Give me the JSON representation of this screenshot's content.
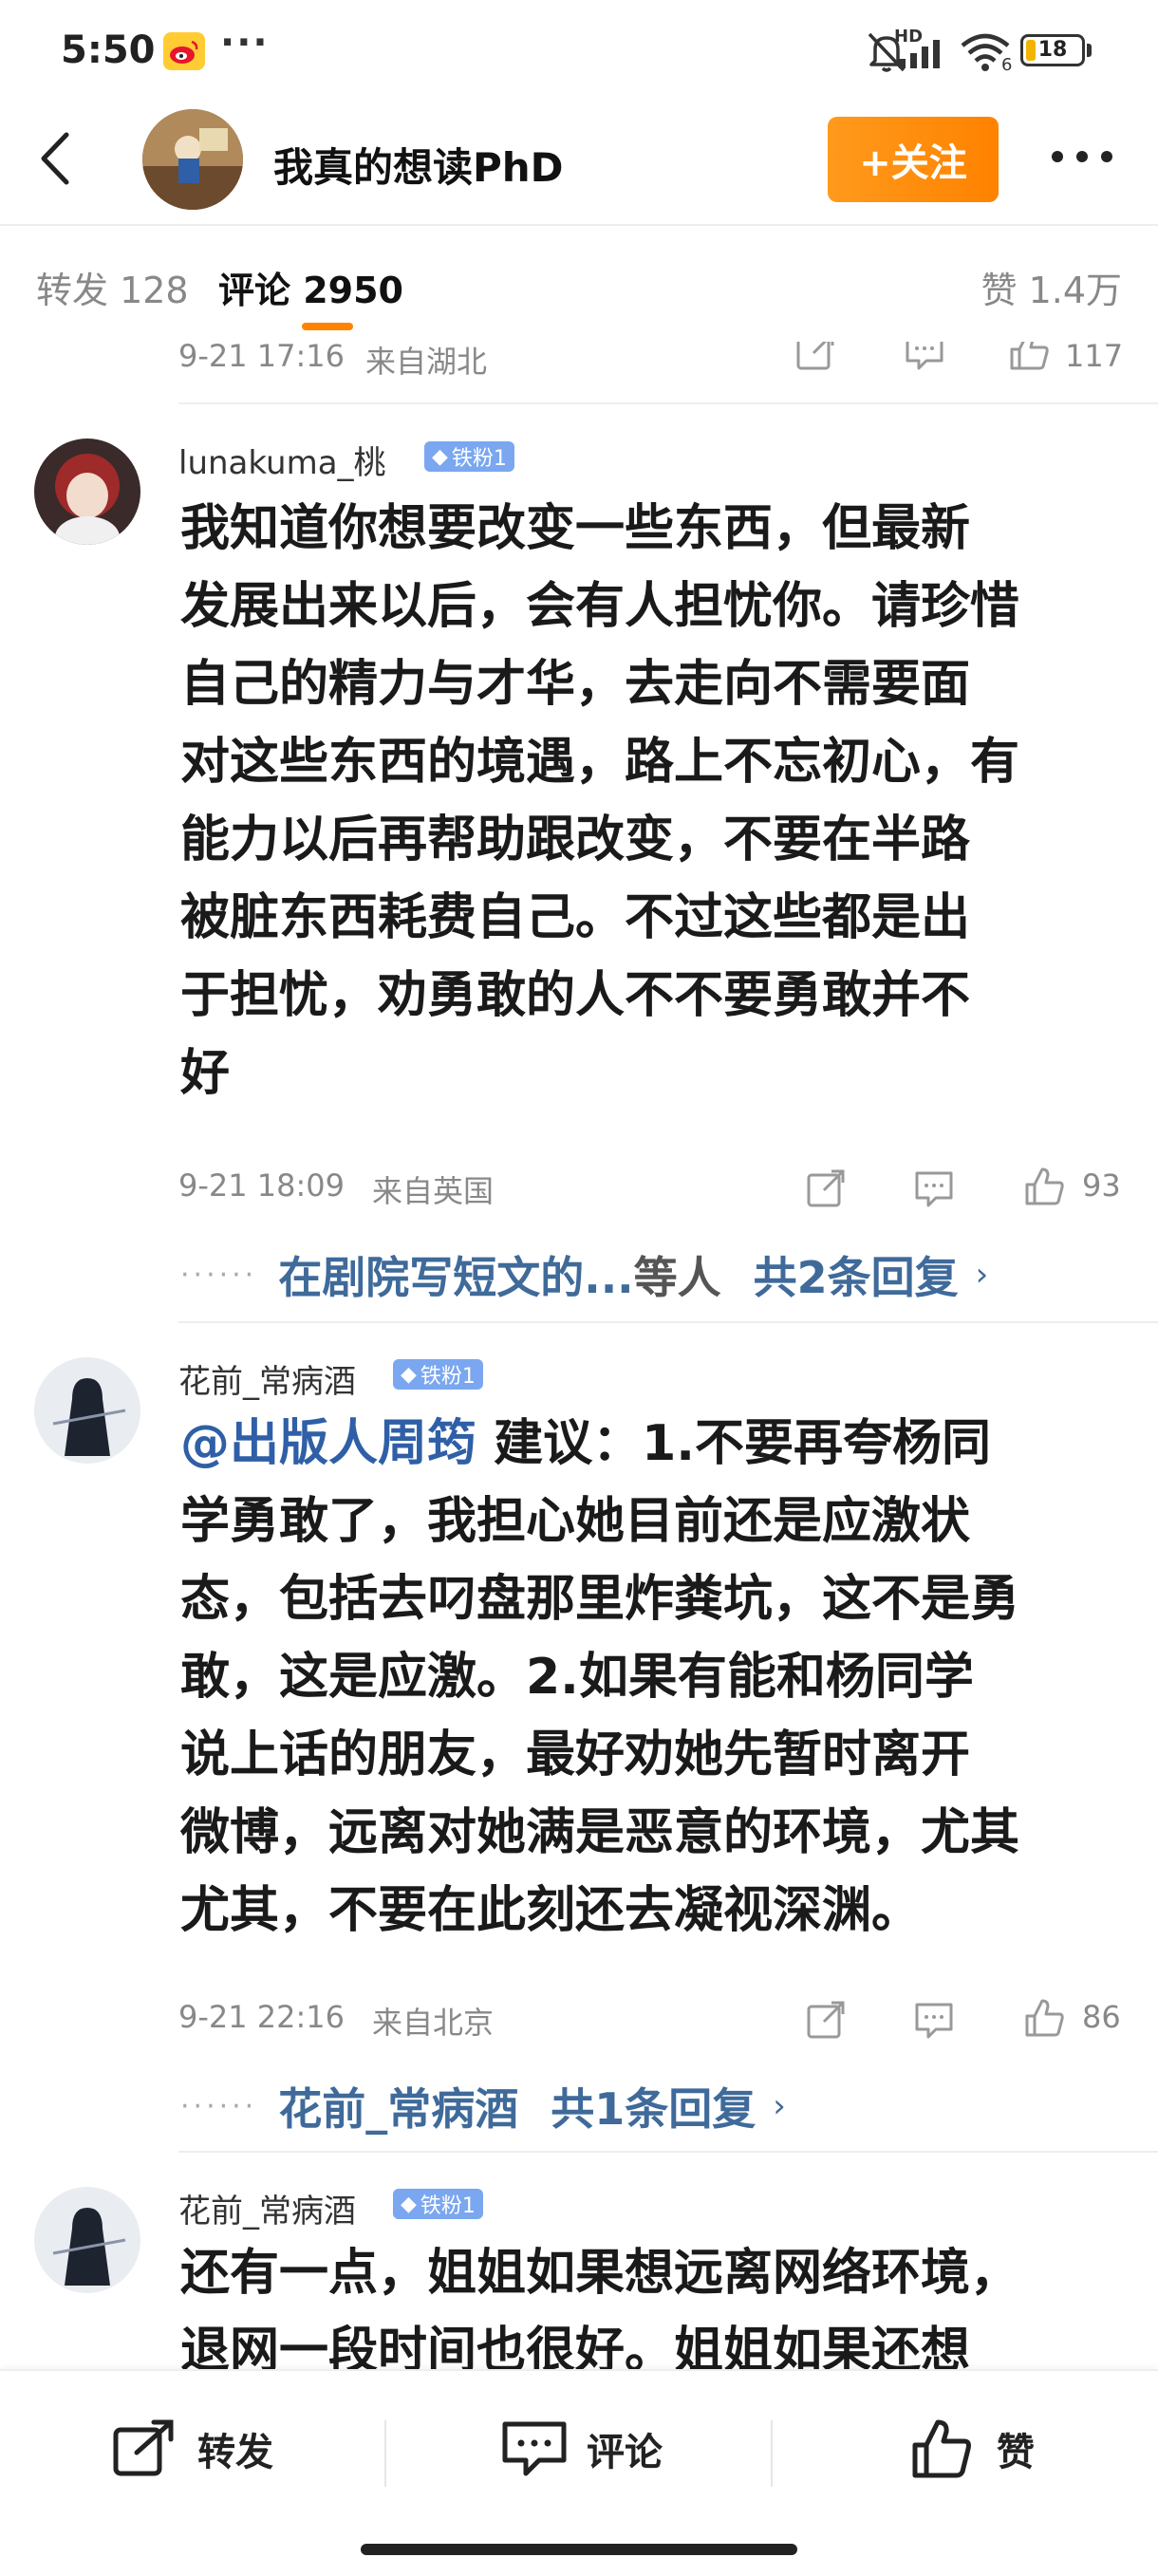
{
  "status_bar": {
    "time": "5:50",
    "dots": "···",
    "signal_label": "HD",
    "wifi_label": "6",
    "battery": "18",
    "battery_level": 0.18
  },
  "header": {
    "title": "我真的想读PhD",
    "follow_label": "+关注"
  },
  "tabs": {
    "repost": "转发 128",
    "comment": "评论 2950",
    "likes": "赞 1.4万"
  },
  "partial_meta": {
    "time": "9-21 17:16",
    "location": "来自湖北",
    "likes": "117"
  },
  "comments": [
    {
      "username": "lunakuma_桃",
      "badge": "铁粉1",
      "lines": [
        "我知道你想要改变一些东西，但最新",
        "发展出来以后，会有人担忧你。请珍惜",
        "自己的精力与才华，去走向不需要面",
        "对这些东西的境遇，路上不忘初心，有",
        "能力以后再帮助跟改变，不要在半路",
        "被脏东西耗费自己。不过这些都是出",
        "于担忧，劝勇敢的人不不要勇敢并不",
        "好"
      ],
      "time": "9-21 18:09",
      "location": "来自英国",
      "likes": "93",
      "reply_from": "在剧院写短文的...",
      "reply_mid": "等人",
      "reply_count": "共2条回复"
    },
    {
      "username": "花前_常病酒",
      "badge": "铁粉1",
      "mention": "@出版人周筠",
      "line1_rest": " 建议：1.不要再夸杨同",
      "lines": [
        "学勇敢了，我担心她目前还是应激状",
        "态，包括去叼盘那里炸粪坑，这不是勇",
        "敢，这是应激。2.如果有能和杨同学",
        "说上话的朋友，最好劝她先暂时离开",
        "微博，远离对她满是恶意的环境，尤其",
        "尤其，不要在此刻还去凝视深渊。"
      ],
      "time": "9-21 22:16",
      "location": "来自北京",
      "likes": "86",
      "reply_from": "花前_常病酒",
      "reply_count": "共1条回复"
    },
    {
      "username": "花前_常病酒",
      "badge": "铁粉1",
      "lines": [
        "还有一点，姐姐如果想远离网络环境，",
        "退网一段时间也很好。姐姐如果还想"
      ]
    }
  ],
  "bottom_bar": {
    "repost": "转发",
    "comment": "评论",
    "like": "赞"
  },
  "colors": {
    "accent": "#ff8200",
    "link": "#3f6a9a",
    "badge": "#7aa7ef"
  }
}
